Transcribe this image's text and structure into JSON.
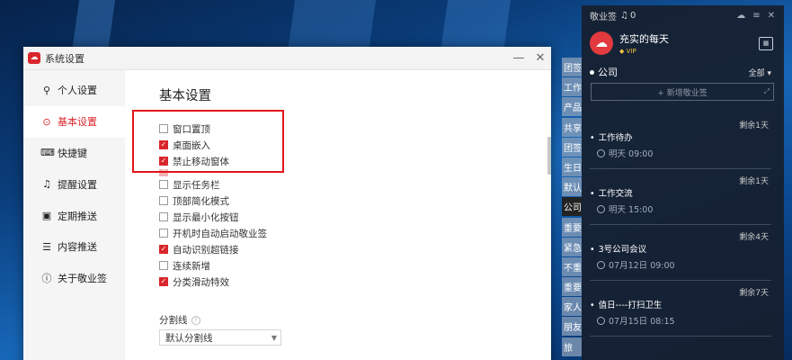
{
  "settings_window": {
    "title": "系统设置",
    "controls": {
      "minimize": "—",
      "close": "✕"
    },
    "sidebar": [
      {
        "icon": "user-icon",
        "glyph": "⚲",
        "label": "个人设置"
      },
      {
        "icon": "gear-icon",
        "glyph": "⊙",
        "label": "基本设置",
        "active": true
      },
      {
        "icon": "keyboard-icon",
        "glyph": "⌨",
        "label": "快捷键"
      },
      {
        "icon": "bell-icon",
        "glyph": "♫",
        "label": "提醒设置"
      },
      {
        "icon": "schedule-icon",
        "glyph": "▣",
        "label": "定期推送"
      },
      {
        "icon": "content-icon",
        "glyph": "☰",
        "label": "内容推送"
      },
      {
        "icon": "info-icon",
        "glyph": "ⓘ",
        "label": "关于敬业签"
      }
    ],
    "section_title": "基本设置",
    "options": [
      {
        "label": "窗口置顶",
        "checked": false
      },
      {
        "label": "桌面嵌入",
        "checked": true
      },
      {
        "label": "禁止移动窗体",
        "checked": true
      },
      {
        "label": "",
        "checked": true,
        "faded": true
      },
      {
        "label": "显示任务栏",
        "checked": false
      },
      {
        "label": "顶部简化模式",
        "checked": false
      },
      {
        "label": "显示最小化按钮",
        "checked": false
      },
      {
        "label": "开机时自动启动敬业签",
        "checked": false
      },
      {
        "label": "自动识别超链接",
        "checked": true
      },
      {
        "label": "连续新增",
        "checked": false
      },
      {
        "label": "分类滑动特效",
        "checked": true
      }
    ],
    "divider_label": "分割线",
    "divider_select": "默认分割线"
  },
  "side_tabs": [
    "团签",
    "工作",
    "产品",
    "共享",
    "团签",
    "生日",
    "默认",
    "公司",
    "重要",
    "紧急",
    "不重",
    "重要",
    "家人",
    "朋友",
    "旅"
  ],
  "active_tab": 7,
  "notes_panel": {
    "app_name": "敬业签",
    "notification_count": "0",
    "user_name": "充实的每天",
    "vip_label": "VIP",
    "category": "公司",
    "category_selector": "全部 ▾",
    "add_placeholder": "+ 新增敬业签",
    "notes": [
      {
        "remaining": "剩余1天",
        "title": "工作待办",
        "time": "明天 09:00"
      },
      {
        "remaining": "剩余1天",
        "title": "工作交流",
        "time": "明天 15:00"
      },
      {
        "remaining": "剩余4天",
        "title": "3号公司会议",
        "time": "07月12日 09:00"
      },
      {
        "remaining": "剩余7天",
        "title": "值日----打扫卫生",
        "time": "07月15日 08:15"
      }
    ]
  },
  "colors": {
    "accent": "#d9262c",
    "panel_bg": "#162030",
    "highlight": "#e1141b"
  }
}
